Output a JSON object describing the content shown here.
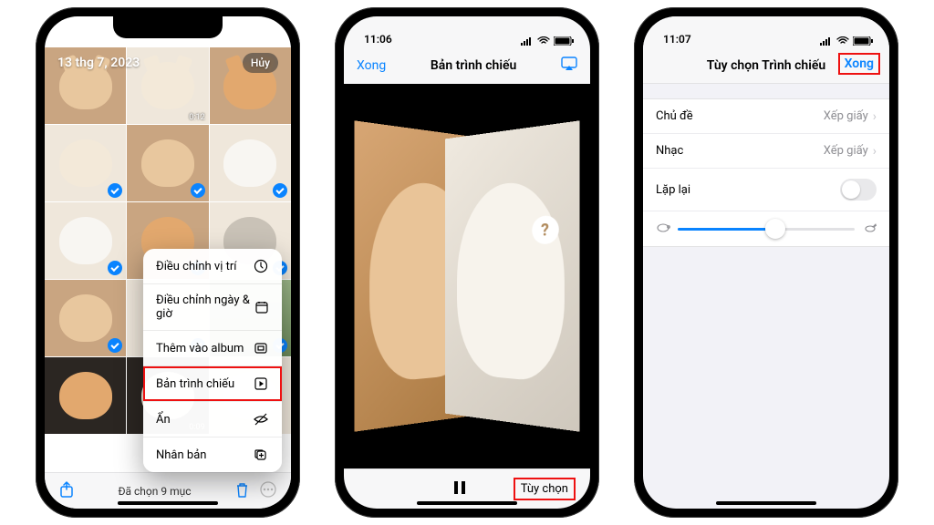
{
  "status": {
    "time": "11:06",
    "time_alt": "11:07",
    "battery_pct": "89"
  },
  "phone1": {
    "date_title": "13 thg 7, 2023",
    "cancel": "Hủy",
    "thumbs": [
      {
        "dur": ""
      },
      {
        "dur": "0:12"
      },
      {
        "dur": ""
      },
      {
        "sel": true
      },
      {
        "sel": true
      },
      {
        "sel": true
      },
      {
        "sel": true
      },
      {
        "sel": true
      },
      {
        "sel": true
      },
      {
        "sel": true
      },
      {
        "sel": true
      },
      {
        "sel": true
      },
      {
        "dur": ""
      },
      {
        "dur": "0:09"
      },
      {
        "dur": ""
      }
    ],
    "menu": [
      {
        "label": "Điều chỉnh vị trí",
        "icon": "clock"
      },
      {
        "label": "Điều chỉnh ngày & giờ",
        "icon": "calendar"
      },
      {
        "label": "Thêm vào album",
        "icon": "album"
      },
      {
        "label": "Bản trình chiếu",
        "icon": "play",
        "hl": true
      },
      {
        "label": "Ẩn",
        "icon": "hide"
      },
      {
        "label": "Nhân bản",
        "icon": "dup"
      }
    ],
    "toolbar": {
      "selected": "Đã chọn 9 mục"
    }
  },
  "phone2": {
    "done": "Xong",
    "title": "Bản trình chiếu",
    "options": "Tùy chọn"
  },
  "phone3": {
    "title": "Tùy chọn Trình chiếu",
    "done": "Xong",
    "rows": {
      "theme_label": "Chủ đề",
      "theme_value": "Xếp giấy",
      "music_label": "Nhạc",
      "music_value": "Xếp giấy",
      "repeat_label": "Lặp lại"
    },
    "speed_pct": 55
  }
}
